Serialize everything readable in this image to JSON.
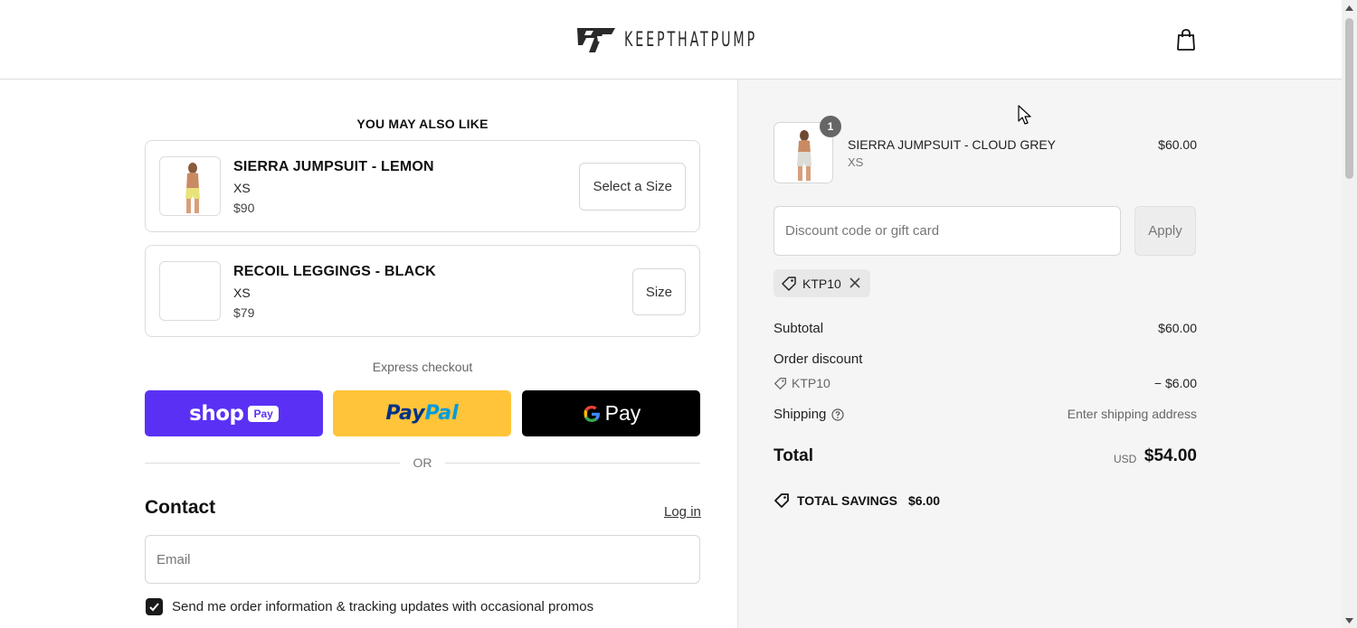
{
  "header": {
    "brand": "KEEPTHATPUMP",
    "logo_icon": "keepthatpump-logo-icon",
    "cart_icon": "shopping-bag-icon"
  },
  "upsell": {
    "title": "YOU MAY ALSO LIKE",
    "items": [
      {
        "name": "SIERRA JUMPSUIT - LEMON",
        "size": "XS",
        "price": "$90",
        "button": "Select a Size"
      },
      {
        "name": "RECOIL LEGGINGS - BLACK",
        "size": "XS",
        "price": "$79",
        "button": "Size"
      }
    ]
  },
  "express": {
    "label": "Express checkout",
    "shop_pay": {
      "word": "shop",
      "pill": "Pay"
    },
    "paypal": {
      "part1": "Pay",
      "part2": "Pal"
    },
    "gpay": {
      "word": "Pay"
    },
    "or_text": "OR",
    "colors": {
      "shop_pay": "#5a31f4",
      "paypal": "#ffc439",
      "gpay": "#000000"
    }
  },
  "contact": {
    "heading": "Contact",
    "login_link": "Log in",
    "email_placeholder": "Email",
    "marketing_label": "Send me order information & tracking updates with occasional promos",
    "marketing_checked": true
  },
  "order": {
    "item": {
      "name": "SIERRA JUMPSUIT - CLOUD GREY",
      "variant": "XS",
      "price": "$60.00",
      "quantity": "1"
    },
    "discount_placeholder": "Discount code or gift card",
    "apply_label": "Apply",
    "applied_code": "KTP10",
    "subtotal_label": "Subtotal",
    "subtotal_value": "$60.00",
    "order_discount_label": "Order discount",
    "discount_code": "KTP10",
    "discount_amount": "− $6.00",
    "shipping_label": "Shipping",
    "shipping_value": "Enter shipping address",
    "total_label": "Total",
    "total_currency": "USD",
    "total_value": "$54.00",
    "savings_label": "TOTAL SAVINGS",
    "savings_value": "$6.00"
  }
}
